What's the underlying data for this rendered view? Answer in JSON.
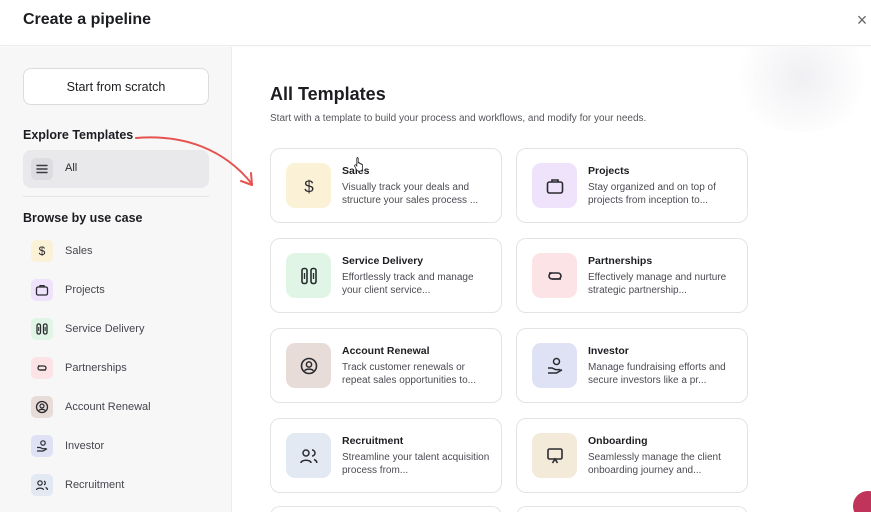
{
  "header": {
    "title": "Create a pipeline",
    "close_icon": "×"
  },
  "sidebar": {
    "scratch_button": "Start from scratch",
    "explore_heading": "Explore Templates",
    "all_item": {
      "label": "All",
      "icon": "list-icon"
    },
    "browse_heading": "Browse by use case",
    "items": [
      {
        "label": "Sales",
        "icon": "dollar-icon",
        "color": "#fbf1d6"
      },
      {
        "label": "Projects",
        "icon": "briefcase-icon",
        "color": "#eee3fb"
      },
      {
        "label": "Service Delivery",
        "icon": "service-icon",
        "color": "#e1f5e7"
      },
      {
        "label": "Partnerships",
        "icon": "handshake-icon",
        "color": "#fbe3e6"
      },
      {
        "label": "Account Renewal",
        "icon": "user-circle-icon",
        "color": "#e8dcd9"
      },
      {
        "label": "Investor",
        "icon": "investor-icon",
        "color": "#dfe1f5"
      },
      {
        "label": "Recruitment",
        "icon": "users-icon",
        "color": "#e2e9f2"
      }
    ]
  },
  "main": {
    "title": "All Templates",
    "subtitle": "Start with a template to build your process and workflows, and modify for your needs.",
    "templates": [
      {
        "title": "Sales",
        "desc": "Visually track your deals and structure your sales process ...",
        "icon": "dollar-icon",
        "color": "#fbf1d6"
      },
      {
        "title": "Projects",
        "desc": "Stay organized and on top of projects from inception to...",
        "icon": "briefcase-icon",
        "color": "#eee3fb"
      },
      {
        "title": "Service Delivery",
        "desc": "Effortlessly track and manage your client service...",
        "icon": "service-icon",
        "color": "#e1f5e7"
      },
      {
        "title": "Partnerships",
        "desc": "Effectively manage and nurture strategic partnership...",
        "icon": "handshake-icon",
        "color": "#fbe3e6"
      },
      {
        "title": "Account Renewal",
        "desc": "Track customer renewals or repeat sales opportunities to...",
        "icon": "user-circle-icon",
        "color": "#e8dcd9"
      },
      {
        "title": "Investor",
        "desc": "Manage fundraising efforts and secure investors like a pr...",
        "icon": "investor-icon",
        "color": "#dfe1f5"
      },
      {
        "title": "Recruitment",
        "desc": "Streamline your talent acquisition process from...",
        "icon": "users-icon",
        "color": "#e2e9f2"
      },
      {
        "title": "Onboarding",
        "desc": "Seamlessly manage the client onboarding journey and...",
        "icon": "presentation-icon",
        "color": "#f3ead9"
      }
    ]
  },
  "annotation": {
    "arrow_color": "#e5524f"
  }
}
